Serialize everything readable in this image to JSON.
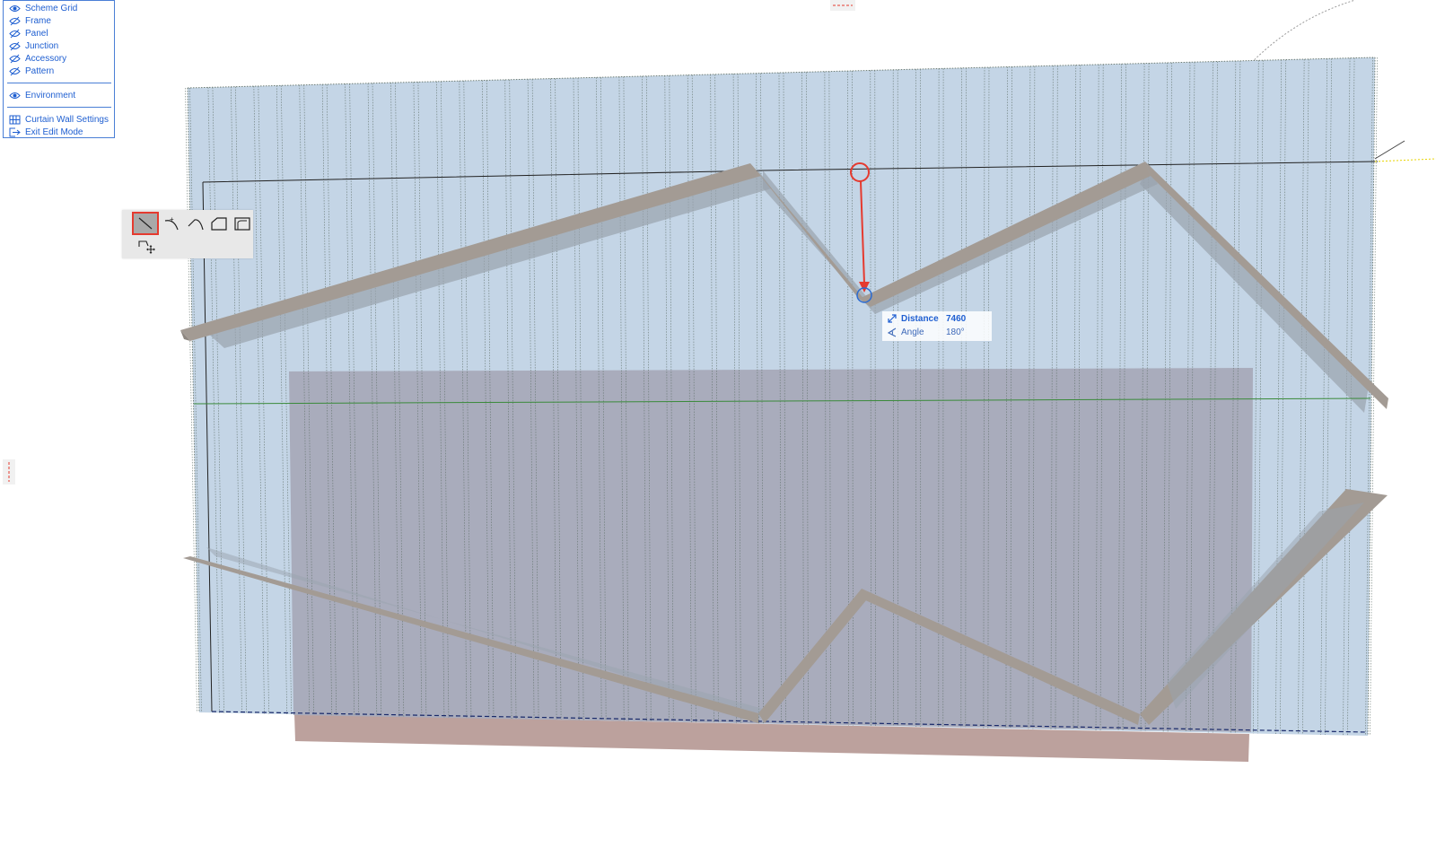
{
  "palette": {
    "items": [
      {
        "label": "Scheme Grid",
        "icon": "eye-icon"
      },
      {
        "label": "Frame",
        "icon": "eye-hidden-icon"
      },
      {
        "label": "Panel",
        "icon": "eye-hidden-icon"
      },
      {
        "label": "Junction",
        "icon": "eye-hidden-icon"
      },
      {
        "label": "Accessory",
        "icon": "eye-hidden-icon"
      },
      {
        "label": "Pattern",
        "icon": "eye-hidden-icon"
      }
    ],
    "environment": {
      "label": "Environment",
      "icon": "eye-icon"
    },
    "settings": {
      "label": "Curtain Wall Settings",
      "icon": "grid-settings-icon"
    },
    "exit": {
      "label": "Exit Edit Mode",
      "icon": "exit-icon"
    }
  },
  "method_palette": {
    "tools": [
      {
        "icon": "straight-line-icon",
        "selected": true
      },
      {
        "icon": "arc-line-icon",
        "selected": false
      },
      {
        "icon": "tangent-arc-icon",
        "selected": false
      },
      {
        "icon": "chamfer-corner-icon",
        "selected": false
      },
      {
        "icon": "fillet-corner-icon",
        "selected": false
      },
      {
        "icon": "move-node-icon",
        "selected": false
      }
    ]
  },
  "tracker": {
    "distance_label": "Distance",
    "distance_value": "7460",
    "angle_label": "Angle",
    "angle_value": "180°"
  },
  "colors": {
    "accent": "#1f5fd1",
    "highlight": "#e53a2f",
    "glass": "#c4d5e6",
    "frame": "#a39b94",
    "building": "#a8aab9",
    "slab": "#b89c98",
    "reference_line": "#3a8a3a"
  }
}
